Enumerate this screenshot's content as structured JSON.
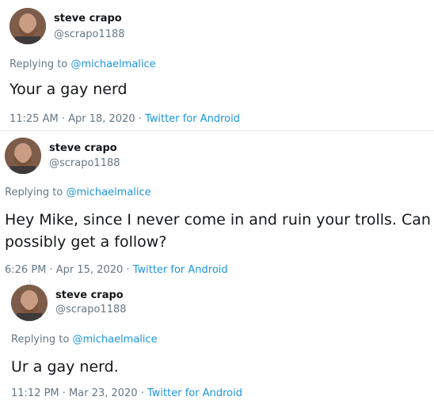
{
  "tweets": [
    {
      "name": "steve crapo",
      "handle": "@scrapo1188",
      "replying_prefix": "Replying to ",
      "replying_to": "@michaelmalice",
      "text": "Your a gay nerd",
      "timestamp": "11:25 AM · Apr 18, 2020 · ",
      "source": "Twitter for Android"
    },
    {
      "name": "steve crapo",
      "handle": "@scrapo1188",
      "replying_prefix": "Replying to ",
      "replying_to": "@michaelmalice",
      "text_line1": "Hey Mike, since I never come in and ruin your trolls. Can I",
      "text_line2": "possibly get a follow?",
      "timestamp": "6:26 PM · Apr 15, 2020 · ",
      "source": "Twitter for Android"
    },
    {
      "name": "steve crapo",
      "handle": "@scrapo1188",
      "replying_prefix": "Replying to ",
      "replying_to": "@michaelmalice",
      "text": "Ur a gay nerd.",
      "timestamp": "11:12 PM · Mar 23, 2020 · ",
      "source": "Twitter for Android"
    }
  ],
  "colors": {
    "text": "#14171a",
    "secondary": "#657786",
    "link": "#1b95e0",
    "border": "#e1e8ed"
  }
}
